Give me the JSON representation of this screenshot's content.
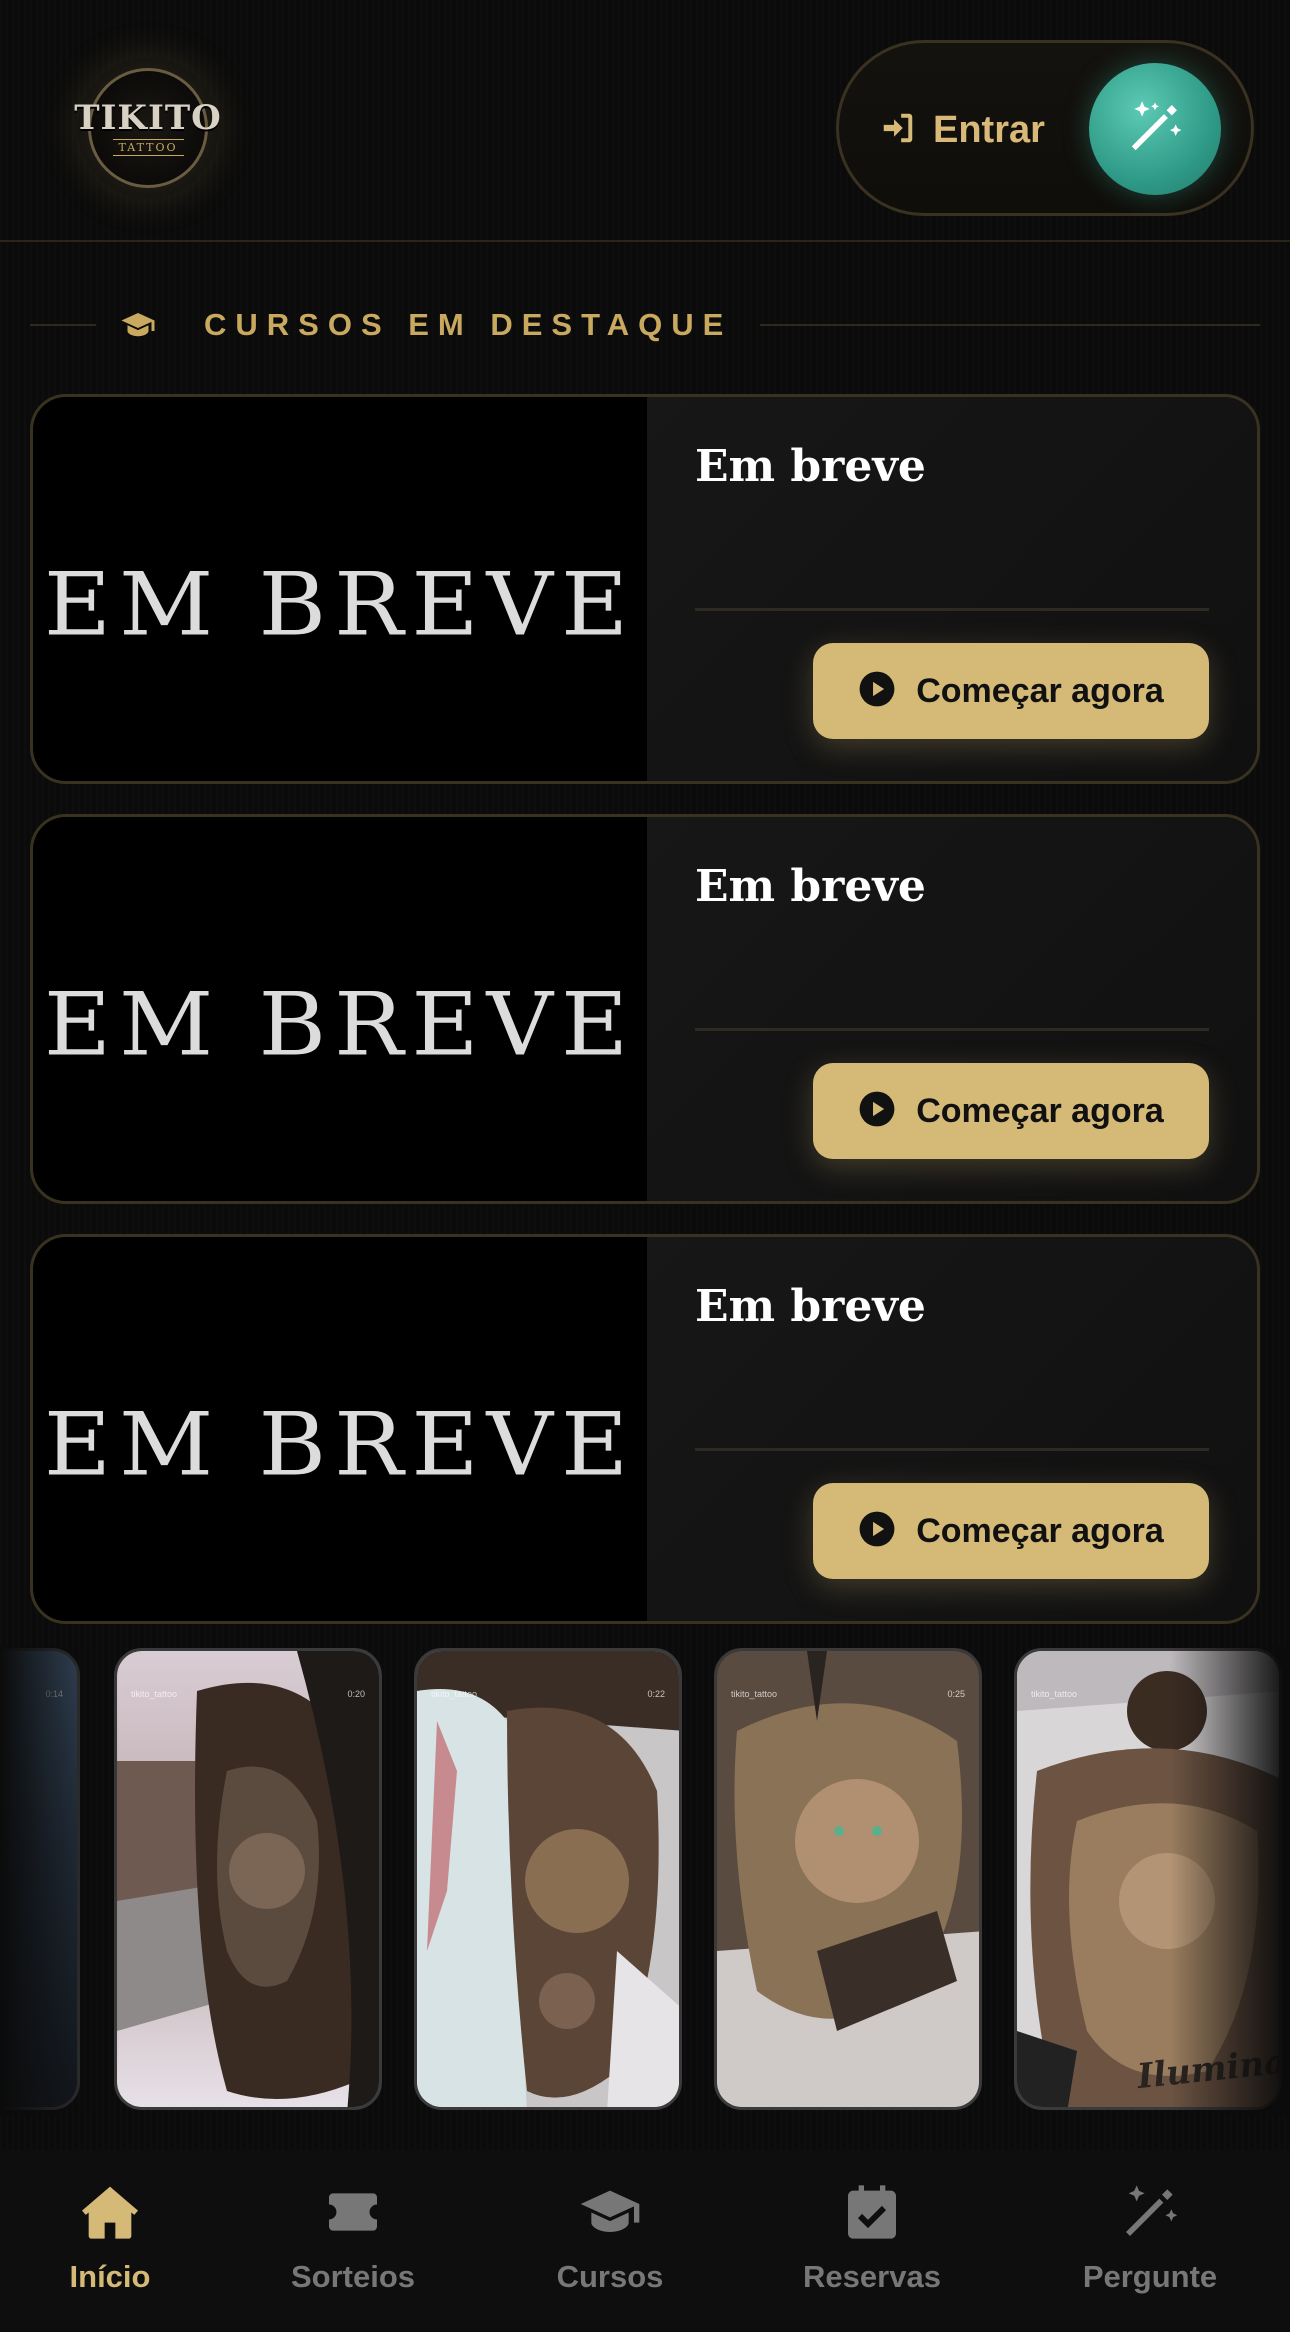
{
  "header": {
    "logo_text": "TIKITO",
    "logo_sub": "TATTOO",
    "login_label": "Entrar"
  },
  "section": {
    "title": "CURSOS EM DESTAQUE"
  },
  "courses": [
    {
      "thumb_text": "EM BREVE",
      "title": "Em breve",
      "cta": "Começar agora"
    },
    {
      "thumb_text": "EM BREVE",
      "title": "Em breve",
      "cta": "Começar agora"
    },
    {
      "thumb_text": "EM BREVE",
      "title": "Em breve",
      "cta": "Começar agora"
    }
  ],
  "reels": [
    {
      "handle": "",
      "time": "0:14"
    },
    {
      "handle": "tikito_tattoo",
      "time": "0:20"
    },
    {
      "handle": "tikito_tattoo",
      "time": "0:22"
    },
    {
      "handle": "tikito_tattoo",
      "time": "0:25"
    },
    {
      "handle": "tikito_tattoo",
      "time": ""
    }
  ],
  "reel_caption": "Iluminado",
  "nav": {
    "items": [
      {
        "label": "Início",
        "icon": "home-icon",
        "active": true
      },
      {
        "label": "Sorteios",
        "icon": "ticket-icon",
        "active": false
      },
      {
        "label": "Cursos",
        "icon": "graduation-cap-icon",
        "active": false
      },
      {
        "label": "Reservas",
        "icon": "calendar-check-icon",
        "active": false
      },
      {
        "label": "Pergunte",
        "icon": "magic-wand-icon",
        "active": false
      }
    ]
  },
  "colors": {
    "accent_gold": "#d4b977",
    "magic_teal": "#2f9b88",
    "background": "#0b0b0b",
    "inactive_nav": "#777777"
  }
}
